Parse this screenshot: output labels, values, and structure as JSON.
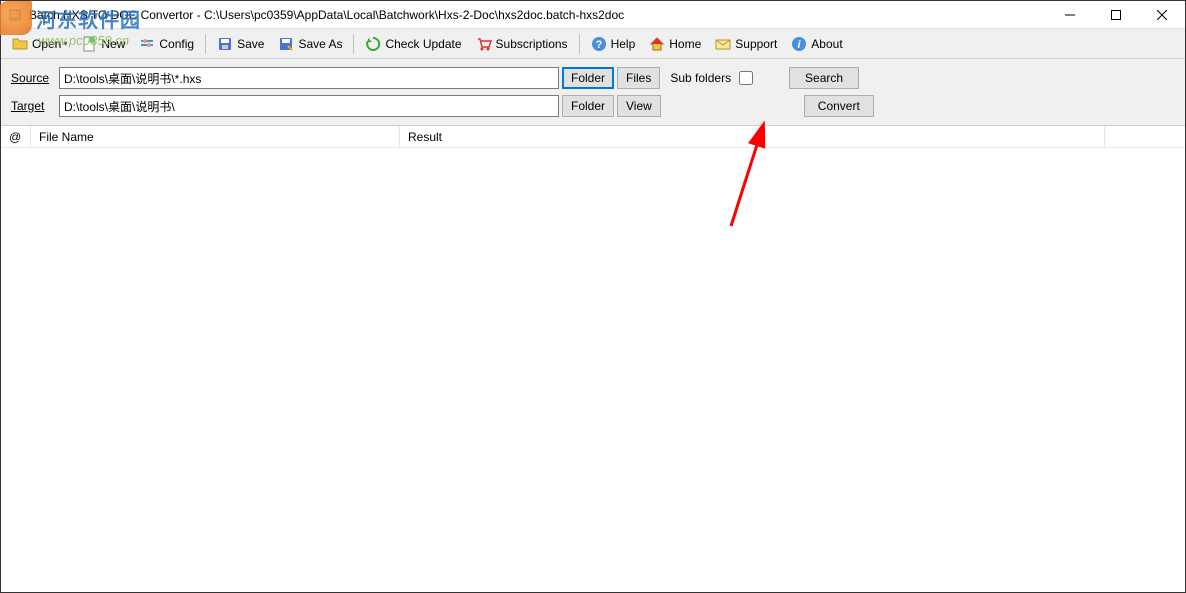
{
  "window": {
    "title": "Batch HXS TO DOC Convertor - C:\\Users\\pc0359\\AppData\\Local\\Batchwork\\Hxs-2-Doc\\hxs2doc.batch-hxs2doc"
  },
  "toolbar": {
    "open": "Open",
    "new": "New",
    "config": "Config",
    "save": "Save",
    "save_as": "Save As",
    "check_update": "Check Update",
    "subscriptions": "Subscriptions",
    "help": "Help",
    "home": "Home",
    "support": "Support",
    "about": "About"
  },
  "form": {
    "source_label": "Source",
    "source_value": "D:\\tools\\桌面\\说明书\\*.hxs",
    "target_label": "Target",
    "target_value": "D:\\tools\\桌面\\说明书\\",
    "folder_btn": "Folder",
    "files_btn": "Files",
    "view_btn": "View",
    "subfolders_label": "Sub folders",
    "search_btn": "Search",
    "convert_btn": "Convert"
  },
  "table": {
    "col_at": "@",
    "col_filename": "File Name",
    "col_result": "Result"
  },
  "watermark": {
    "cn": "河东软件园",
    "url": "www.pc0359.cn"
  }
}
